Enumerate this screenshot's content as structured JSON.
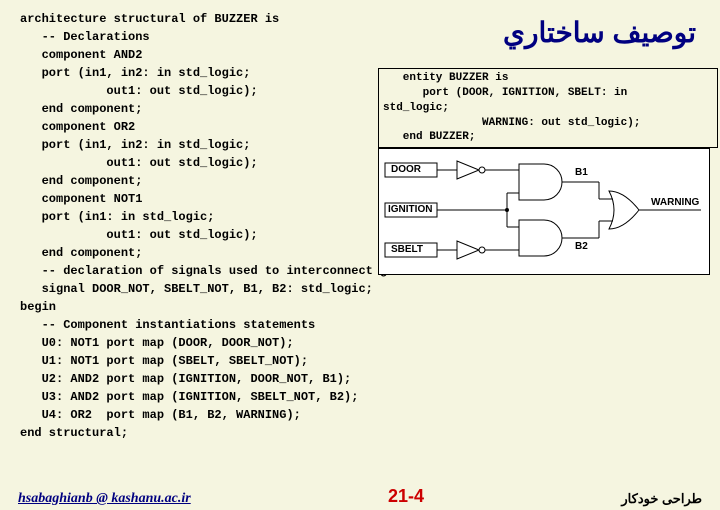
{
  "heading_ar": "توصيف ساختاري",
  "code": {
    "l0": "architecture structural of BUZZER is",
    "l1": "   -- Declarations",
    "l2": "   component AND2",
    "l3": "   port (in1, in2: in std_logic;",
    "l4": "            out1: out std_logic);",
    "l5": "   end component;",
    "l6": "   component OR2",
    "l7": "   port (in1, in2: in std_logic;",
    "l8": "            out1: out std_logic);",
    "l9": "   end component;",
    "l10": "   component NOT1",
    "l11": "   port (in1: in std_logic;",
    "l12": "            out1: out std_logic);",
    "l13": "   end component;",
    "l14": "   -- declaration of signals used to interconnect gates",
    "l15": "   signal DOOR_NOT, SBELT_NOT, B1, B2: std_logic;",
    "l16": "begin",
    "l17": "   -- Component instantiations statements",
    "l18": "   U0: NOT1 port map (DOOR, DOOR_NOT);",
    "l19": "   U1: NOT1 port map (SBELT, SBELT_NOT);",
    "l20": "   U2: AND2 port map (IGNITION, DOOR_NOT, B1);",
    "l21": "   U3: AND2 port map (IGNITION, SBELT_NOT, B2);",
    "l22": "   U4: OR2  port map (B1, B2, WARNING);",
    "l23": "end structural;"
  },
  "entity": {
    "e0": "   entity BUZZER is",
    "e1": "      port (DOOR, IGNITION, SBELT: in",
    "e2": "std_logic;",
    "e3": "               WARNING: out std_logic);",
    "e4": "   end BUZZER;"
  },
  "diagram": {
    "door": "DOOR",
    "ignition": "IGNITION",
    "sbelt": "SBELT",
    "b1": "B1",
    "b2": "B2",
    "warning": "WARNING"
  },
  "footer": {
    "left": "hsabaghianb @ kashanu.ac.ir",
    "center": "21-4",
    "right": "طراحی خودکار"
  }
}
